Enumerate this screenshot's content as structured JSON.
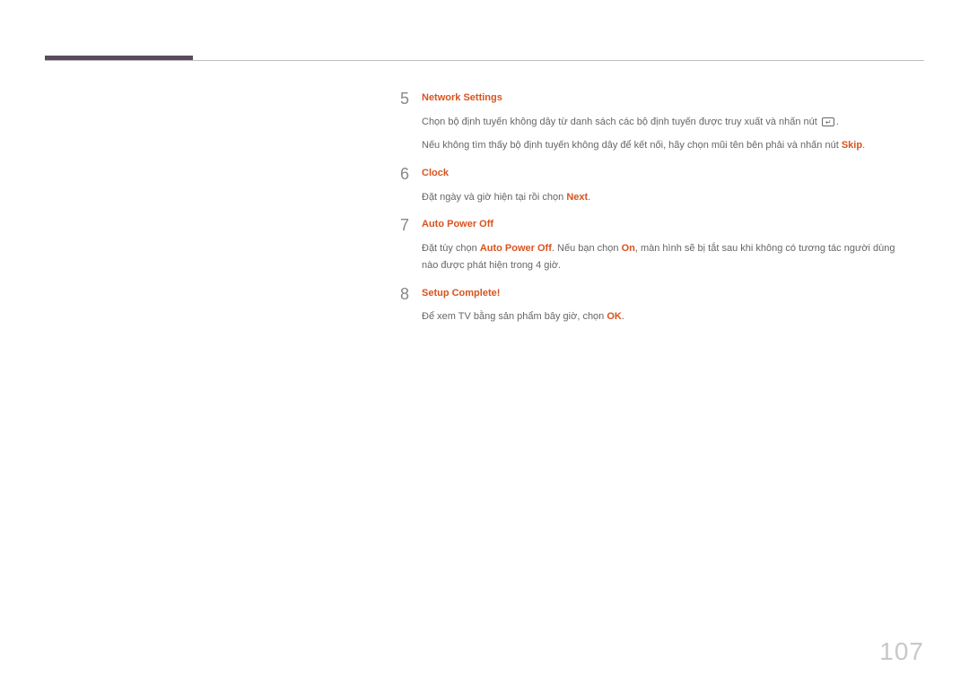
{
  "page_number": "107",
  "steps": [
    {
      "number": "5",
      "title": "Network Settings",
      "desc_before": "Chọn bộ định tuyến không dây từ danh sách các bộ định tuyến được truy xuất và nhấn nút ",
      "desc_after_icon": ".",
      "line2_before": "Nếu không tìm thấy bộ định tuyến không dây để kết nối, hãy chọn mũi tên bên phải và nhấn nút ",
      "line2_red": "Skip",
      "line2_after": "."
    },
    {
      "number": "6",
      "title": "Clock",
      "desc_before": "Đặt ngày và giờ hiện tại rồi chọn ",
      "desc_red": "Next",
      "desc_after": "."
    },
    {
      "number": "7",
      "title": "Auto Power Off",
      "desc_before": "Đặt tùy chọn ",
      "desc_red1": "Auto Power Off",
      "desc_mid1": ". Nếu bạn chọn ",
      "desc_red2": "On",
      "desc_mid2": ", màn hình sẽ bị tắt sau khi không có tương tác người dùng nào được phát hiện trong 4 giờ."
    },
    {
      "number": "8",
      "title": "Setup Complete!",
      "desc_before": "Để xem TV bằng sản phẩm bây giờ, chọn ",
      "desc_red": "OK",
      "desc_after": "."
    }
  ]
}
